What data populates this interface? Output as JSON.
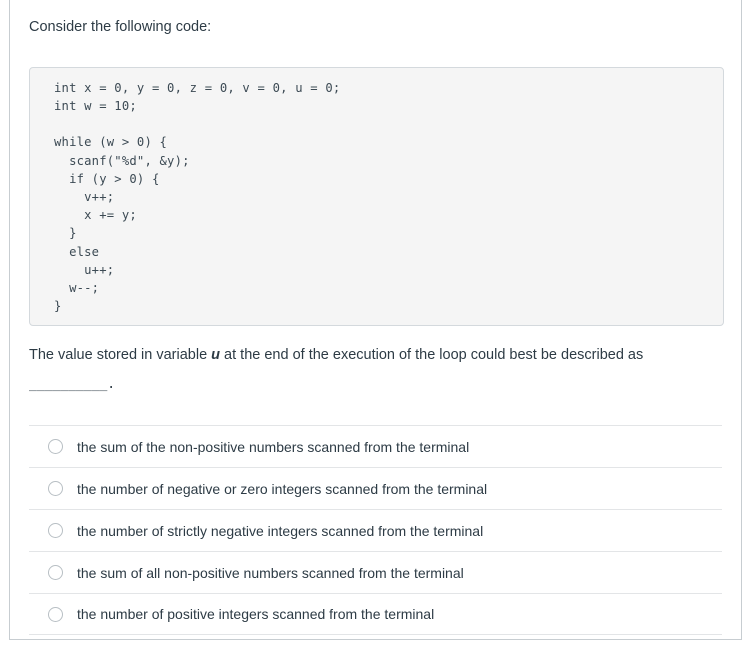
{
  "question": {
    "prompt": "Consider the following code:",
    "code": "int x = 0, y = 0, z = 0, v = 0, u = 0;\nint w = 10;\n\nwhile (w > 0) {\n  scanf(\"%d\", &y);\n  if (y > 0) {\n    v++;\n    x += y;\n  }\n  else\n    u++;\n  w--;\n}",
    "statement_before": "The value stored in variable ",
    "statement_variable": "u",
    "statement_after": " at the end of the execution of the loop could best be described as ",
    "statement_blank": "__________.",
    "answers": [
      {
        "label": "the sum of the non-positive numbers scanned from the terminal",
        "selected": false
      },
      {
        "label": "the number of negative or zero integers scanned from the terminal",
        "selected": false
      },
      {
        "label": "the number of strictly negative integers scanned from the terminal",
        "selected": false
      },
      {
        "label": "the sum of all non-positive numbers scanned from the terminal",
        "selected": false
      },
      {
        "label": "the number of positive integers scanned from the terminal",
        "selected": false
      }
    ]
  },
  "colors": {
    "text": "#2d3b45",
    "code_background": "#f5f5f5",
    "code_border": "#d4d9dd",
    "divider": "#e3e5e7",
    "container_border": "#c7cdd1",
    "radio_border": "#b8bfc4"
  }
}
